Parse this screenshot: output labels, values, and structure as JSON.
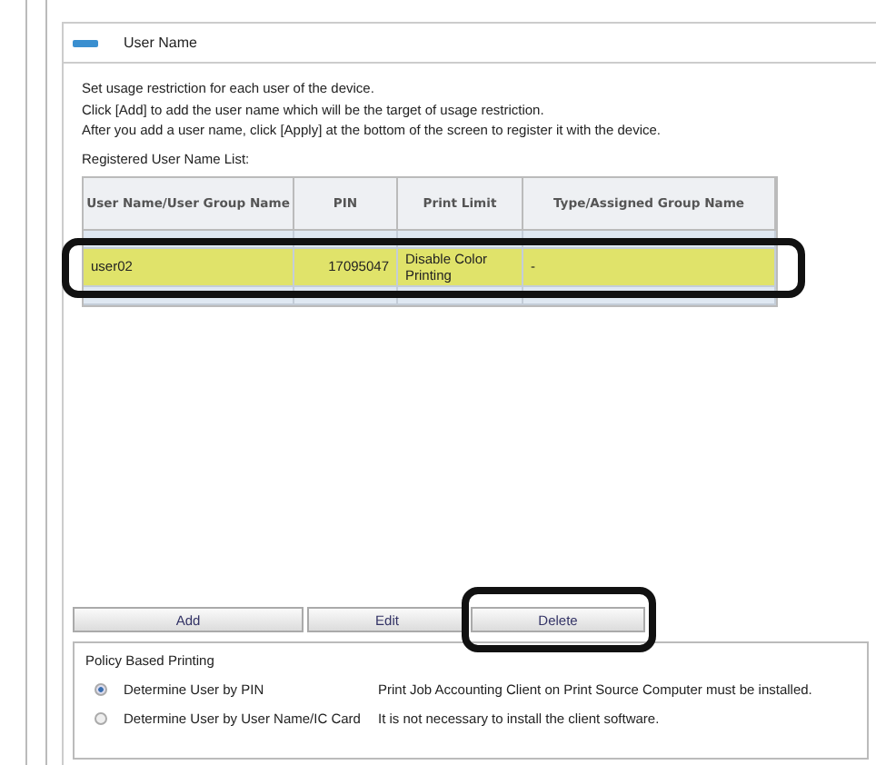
{
  "panel": {
    "title": "User Name"
  },
  "intro": [
    "Set usage restriction for each user of the device.",
    "Click [Add] to add the user name which will be the target of usage restriction.",
    "After you add a user name, click [Apply] at the bottom of the screen to register it with the device."
  ],
  "list_label": "Registered User Name List:",
  "table": {
    "columns": [
      "User Name/User Group Name",
      "PIN",
      "Print Limit",
      "Type/Assigned Group Name"
    ],
    "rows": [
      {
        "selected": false,
        "emphasized": false,
        "cells": []
      },
      {
        "selected": true,
        "emphasized": true,
        "cells": [
          "user02",
          "17095047",
          "Disable Color Printing",
          "-"
        ]
      },
      {
        "selected": false,
        "emphasized": false,
        "cells": []
      }
    ]
  },
  "buttons": [
    {
      "label": "Add",
      "emphasized": false
    },
    {
      "label": "Edit",
      "emphasized": false
    },
    {
      "label": "Delete",
      "emphasized": true
    }
  ],
  "policy": {
    "title": "Policy Based Printing",
    "options": [
      {
        "label": "Determine User by PIN",
        "note": "Print Job Accounting Client on Print Source Computer must be installed.",
        "selected": true
      },
      {
        "label": "Determine User by User Name/IC Card",
        "note": "It is not necessary to install the client software.",
        "selected": false
      }
    ]
  }
}
